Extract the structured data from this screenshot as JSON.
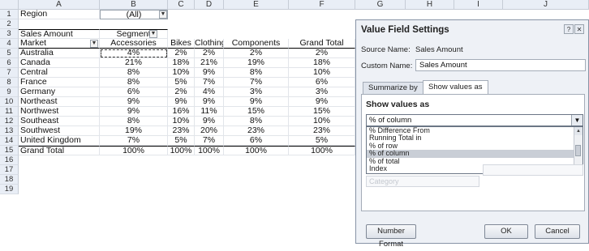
{
  "columns": [
    "A",
    "B",
    "C",
    "D",
    "E",
    "F",
    "G",
    "H",
    "I",
    "J"
  ],
  "rows": [
    "1",
    "2",
    "3",
    "4",
    "5",
    "6",
    "7",
    "8",
    "9",
    "10",
    "11",
    "12",
    "13",
    "14",
    "15",
    "16",
    "17",
    "18",
    "19"
  ],
  "filter": {
    "label": "Region",
    "value": "(All)"
  },
  "pivot": {
    "data_label": "Sales Amount",
    "col_field": "Segment",
    "row_field": "Market",
    "headers": [
      "Accessories",
      "Bikes",
      "Clothing",
      "Components",
      "Grand Total"
    ],
    "markets": [
      "Australia",
      "Canada",
      "Central",
      "France",
      "Germany",
      "Northeast",
      "Northwest",
      "Southeast",
      "Southwest",
      "United Kingdom",
      "Grand Total"
    ],
    "values": [
      [
        "4%",
        "2%",
        "2%",
        "2%",
        "2%"
      ],
      [
        "21%",
        "18%",
        "21%",
        "19%",
        "18%"
      ],
      [
        "8%",
        "10%",
        "9%",
        "8%",
        "10%"
      ],
      [
        "8%",
        "5%",
        "7%",
        "7%",
        "6%"
      ],
      [
        "6%",
        "2%",
        "4%",
        "3%",
        "3%"
      ],
      [
        "9%",
        "9%",
        "9%",
        "9%",
        "9%"
      ],
      [
        "9%",
        "16%",
        "11%",
        "15%",
        "15%"
      ],
      [
        "8%",
        "10%",
        "9%",
        "8%",
        "10%"
      ],
      [
        "19%",
        "23%",
        "20%",
        "23%",
        "23%"
      ],
      [
        "7%",
        "5%",
        "7%",
        "6%",
        "5%"
      ],
      [
        "100%",
        "100%",
        "100%",
        "100%",
        "100%"
      ]
    ]
  },
  "dialog": {
    "title": "Value Field Settings",
    "source_label": "Source Name:",
    "source_value": "Sales Amount",
    "custom_label": "Custom Name:",
    "custom_value": "Sales Amount",
    "tabs": [
      "Summarize by",
      "Show values as"
    ],
    "section_title": "Show values as",
    "selected": "% of column",
    "options": [
      "% Difference From",
      "Running Total in",
      "% of row",
      "% of column",
      "% of total",
      "Index"
    ],
    "ghost_label": "Category",
    "number_format": "Number Format",
    "ok": "OK",
    "cancel": "Cancel"
  }
}
